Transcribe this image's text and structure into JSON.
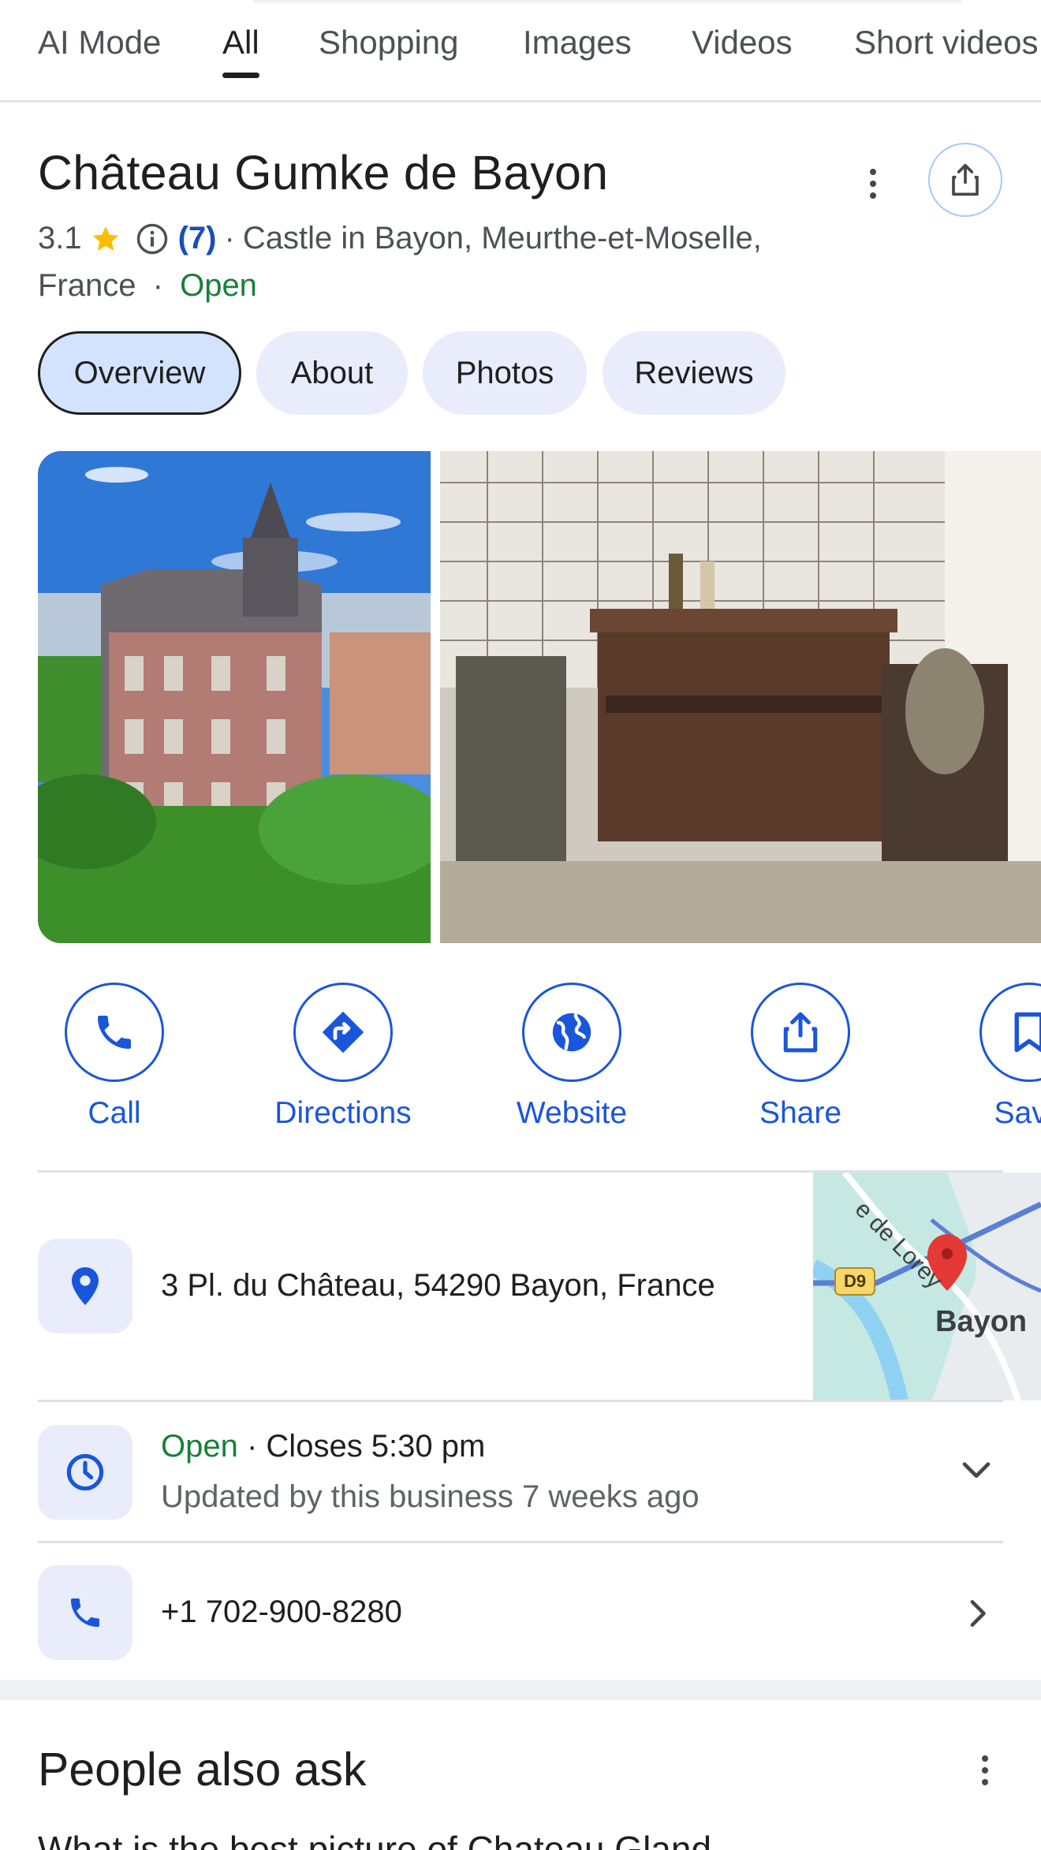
{
  "tabs": [
    {
      "label": "AI Mode"
    },
    {
      "label": "All"
    },
    {
      "label": "Shopping"
    },
    {
      "label": "Images"
    },
    {
      "label": "Videos"
    },
    {
      "label": "Short videos"
    }
  ],
  "active_tab": "All",
  "place": {
    "name": "Château Gumke de Bayon",
    "rating": "3.1",
    "review_count": "(7)",
    "category_line1": "Castle in Bayon, Meurthe-et-Moselle,",
    "category_line2": "France",
    "status": "Open"
  },
  "chips": [
    {
      "label": "Overview"
    },
    {
      "label": "About"
    },
    {
      "label": "Photos"
    },
    {
      "label": "Reviews"
    }
  ],
  "selected_chip": "Overview",
  "actions": [
    {
      "label": "Call",
      "icon": "phone-icon"
    },
    {
      "label": "Directions",
      "icon": "directions-icon"
    },
    {
      "label": "Website",
      "icon": "globe-icon"
    },
    {
      "label": "Share",
      "icon": "share-icon"
    },
    {
      "label": "Save",
      "icon": "bookmark-icon"
    }
  ],
  "address": "3 Pl. du Château, 54290 Bayon, France",
  "map": {
    "road_label": "e de Lorey",
    "route_badge": "D9",
    "town_label": "Bayon"
  },
  "hours": {
    "status": "Open",
    "closes": "Closes 5:30 pm",
    "updated": "Updated by this business 7 weeks ago"
  },
  "phone": "+1 702-900-8280",
  "people_also_ask": {
    "title": "People also ask",
    "first_question": "What is the best picture of Chateau Gland..."
  },
  "colors": {
    "accent_blue": "#1a56db",
    "open_green": "#188038",
    "chip_bg": "#e8ecfb",
    "star": "#fbbc04"
  }
}
